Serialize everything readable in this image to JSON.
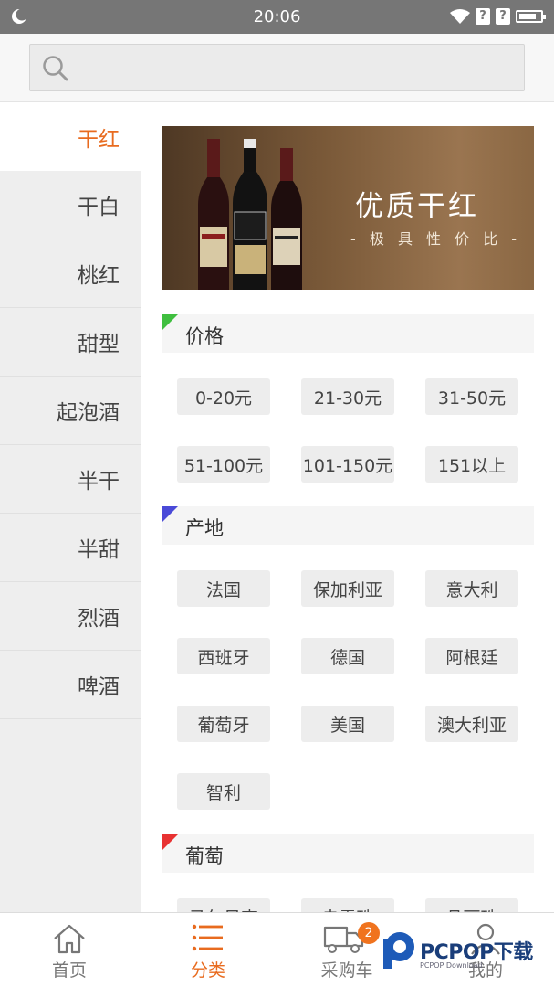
{
  "status_bar": {
    "time": "20:06",
    "sim1": "?",
    "sim2": "?"
  },
  "search": {
    "placeholder": ""
  },
  "sidebar": {
    "items": [
      {
        "label": "干红",
        "active": true
      },
      {
        "label": "干白"
      },
      {
        "label": "桃红"
      },
      {
        "label": "甜型"
      },
      {
        "label": "起泡酒"
      },
      {
        "label": "半干"
      },
      {
        "label": "半甜"
      },
      {
        "label": "烈酒"
      },
      {
        "label": "啤酒"
      }
    ]
  },
  "banner": {
    "title": "优质干红",
    "subtitle": "- 极 具 性 价 比 -"
  },
  "sections": [
    {
      "title": "价格",
      "accent": "#3fbf3f",
      "chips": [
        "0-20元",
        "21-30元",
        "31-50元",
        "51-100元",
        "101-150元",
        "151以上"
      ]
    },
    {
      "title": "产地",
      "accent": "#4a4ad8",
      "chips": [
        "法国",
        "保加利亚",
        "意大利",
        "西班牙",
        "德国",
        "阿根廷",
        "葡萄牙",
        "美国",
        "澳大利亚",
        "智利"
      ]
    },
    {
      "title": "葡萄",
      "accent": "#e83232",
      "chips": [
        "马尔贝克",
        "赤霞珠",
        "品丽珠"
      ]
    }
  ],
  "tabbar": {
    "items": [
      {
        "label": "首页",
        "icon": "home-icon"
      },
      {
        "label": "分类",
        "icon": "category-list-icon",
        "active": true
      },
      {
        "label": "采购车",
        "icon": "truck-icon",
        "badge": "2"
      },
      {
        "label": "我的",
        "icon": "user-icon"
      }
    ]
  },
  "watermark": {
    "text": "PCPOP下载",
    "sub": "PCPOP Download"
  },
  "colors": {
    "accent": "#e86b1f",
    "status_bar": "#767676"
  }
}
